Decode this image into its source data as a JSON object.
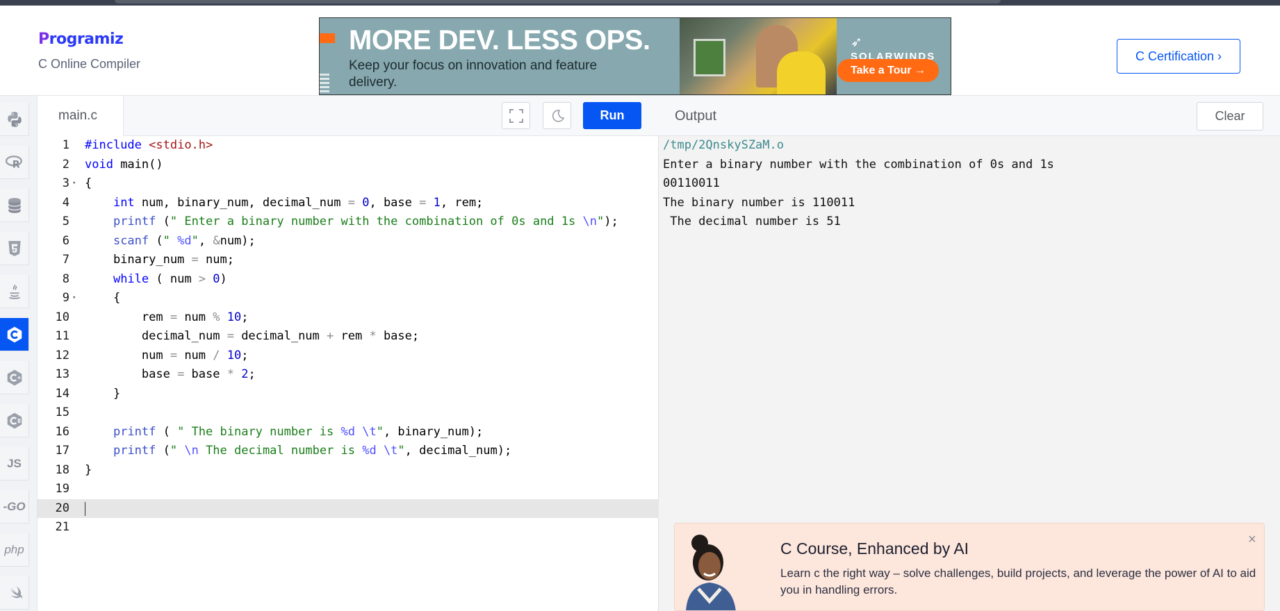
{
  "header": {
    "logo_text": "rogramiz",
    "logo_initial": "P",
    "subtitle": "C Online Compiler",
    "cert_button": "C Certification ›"
  },
  "ad": {
    "headline": "MORE DEV. LESS OPS.",
    "subline": "Keep your focus on innovation and feature delivery.",
    "brand": "SOLARWINDS",
    "cta": "Take a Tour →"
  },
  "languages": [
    "python-icon",
    "r-icon",
    "sql-icon",
    "html5-icon",
    "java-icon",
    "c-icon",
    "cpp-icon",
    "csharp-icon",
    "js",
    "go",
    "php",
    "swift-icon"
  ],
  "language_labels": {
    "js": "JS",
    "go": "-GO",
    "php": "php"
  },
  "editor": {
    "filename": "main.c",
    "run_label": "Run",
    "current_line": 20
  },
  "output": {
    "title": "Output",
    "clear_label": "Clear",
    "lines": [
      "/tmp/2QnskySZaM.o",
      "Enter a binary number with the combination of 0s and 1s",
      "00110011",
      "The binary number is 110011",
      " The decimal number is 51"
    ]
  },
  "promo": {
    "title": "C Course, Enhanced by AI",
    "description": "Learn c the right way – solve challenges, build projects, and leverage the power of AI to aid you in handling errors.",
    "close": "×"
  },
  "colors": {
    "accent": "#0556f3",
    "brand_purple": "#7a30e6",
    "promo_bg": "#fde6dc"
  }
}
